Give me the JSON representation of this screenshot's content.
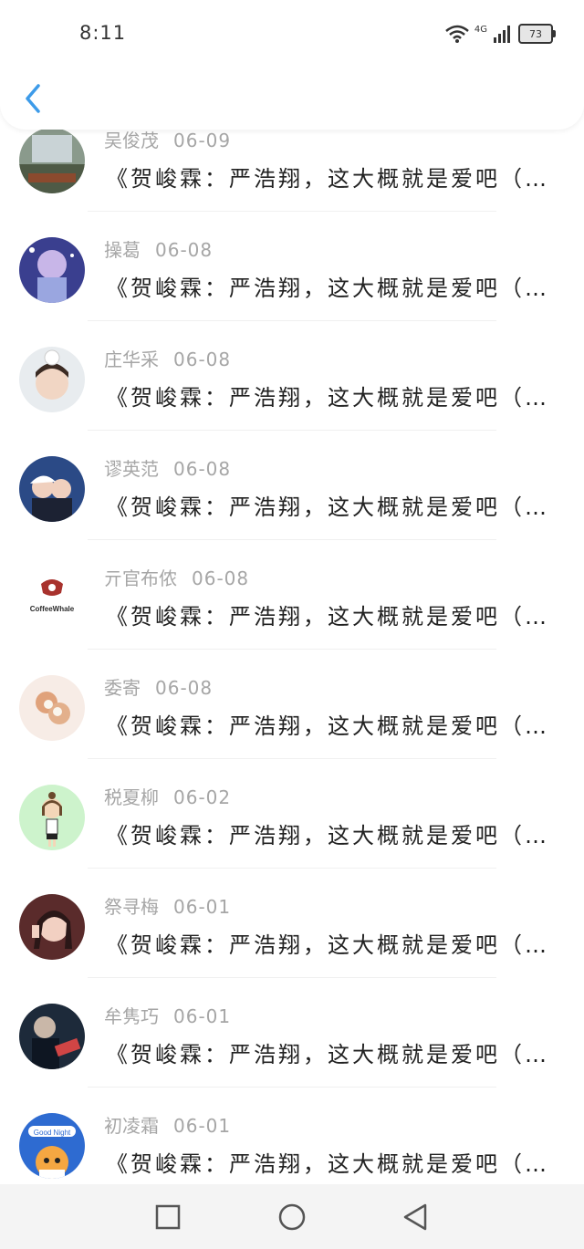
{
  "status_bar": {
    "time": "8:11",
    "network": "4G",
    "battery": "73"
  },
  "messages": [
    {
      "name": "吴俊茂",
      "date": "06-09",
      "text": "《贺峻霖：严浩翔，这大概就是爱吧（…"
    },
    {
      "name": "操葛",
      "date": "06-08",
      "text": "《贺峻霖：严浩翔，这大概就是爱吧（…"
    },
    {
      "name": "庄华采",
      "date": "06-08",
      "text": "《贺峻霖：严浩翔，这大概就是爱吧（…"
    },
    {
      "name": "谬英范",
      "date": "06-08",
      "text": "《贺峻霖：严浩翔，这大概就是爱吧（…"
    },
    {
      "name": "亓官布侬",
      "date": "06-08",
      "text": "《贺峻霖：严浩翔，这大概就是爱吧（…"
    },
    {
      "name": "委寄",
      "date": "06-08",
      "text": "《贺峻霖：严浩翔，这大概就是爱吧（…"
    },
    {
      "name": "税夏柳",
      "date": "06-02",
      "text": "《贺峻霖：严浩翔，这大概就是爱吧（…"
    },
    {
      "name": "祭寻梅",
      "date": "06-01",
      "text": "《贺峻霖：严浩翔，这大概就是爱吧（…"
    },
    {
      "name": "牟隽巧",
      "date": "06-01",
      "text": "《贺峻霖：严浩翔，这大概就是爱吧（…"
    },
    {
      "name": "初凌霜",
      "date": "06-01",
      "text": "《贺峻霖：严浩翔，这大概就是爱吧（…"
    }
  ],
  "avatar_texts": {
    "coffee": "CoffeeWhale",
    "goodnight": "Good Night"
  },
  "colors": {
    "accent": "#3d9be9",
    "meta": "#a6a6a6",
    "text": "#222222"
  }
}
